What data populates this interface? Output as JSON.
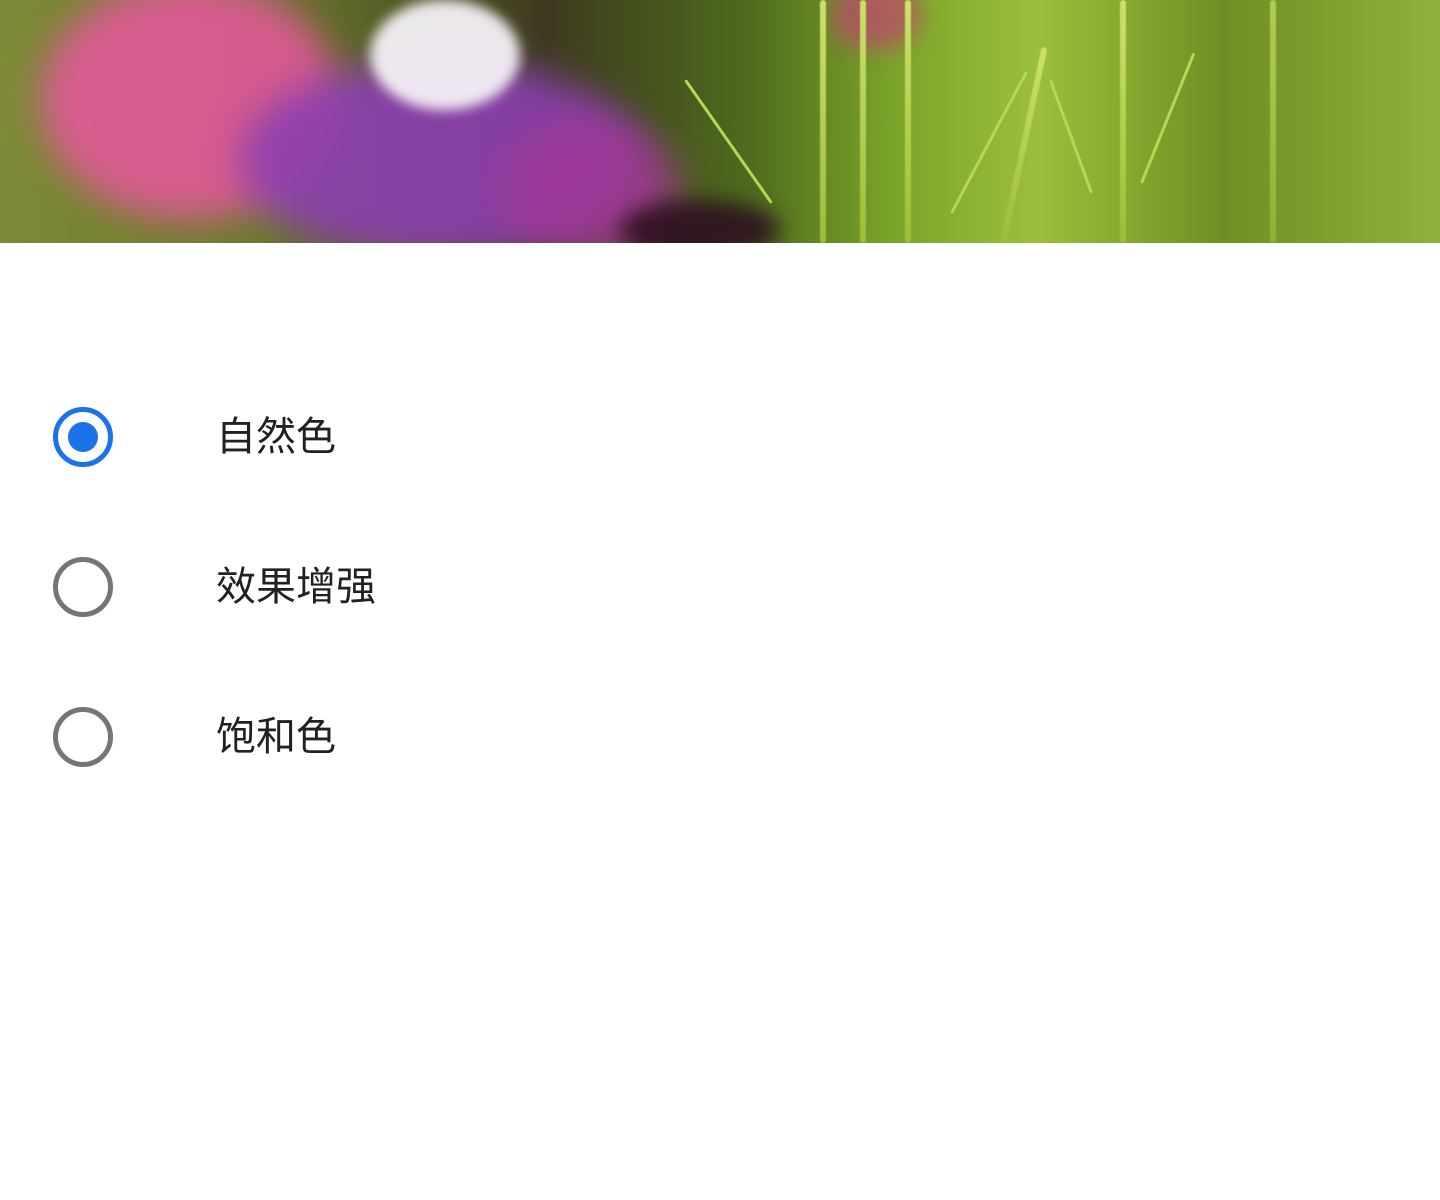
{
  "preview": {
    "image_description_icon": "flower-photo"
  },
  "options": [
    {
      "label": "自然色",
      "selected": true
    },
    {
      "label": "效果增强",
      "selected": false
    },
    {
      "label": "饱和色",
      "selected": false
    }
  ],
  "colors": {
    "accent": "#1a73e8",
    "radio_unchecked": "#757575",
    "text": "#202124",
    "background": "#ffffff"
  }
}
